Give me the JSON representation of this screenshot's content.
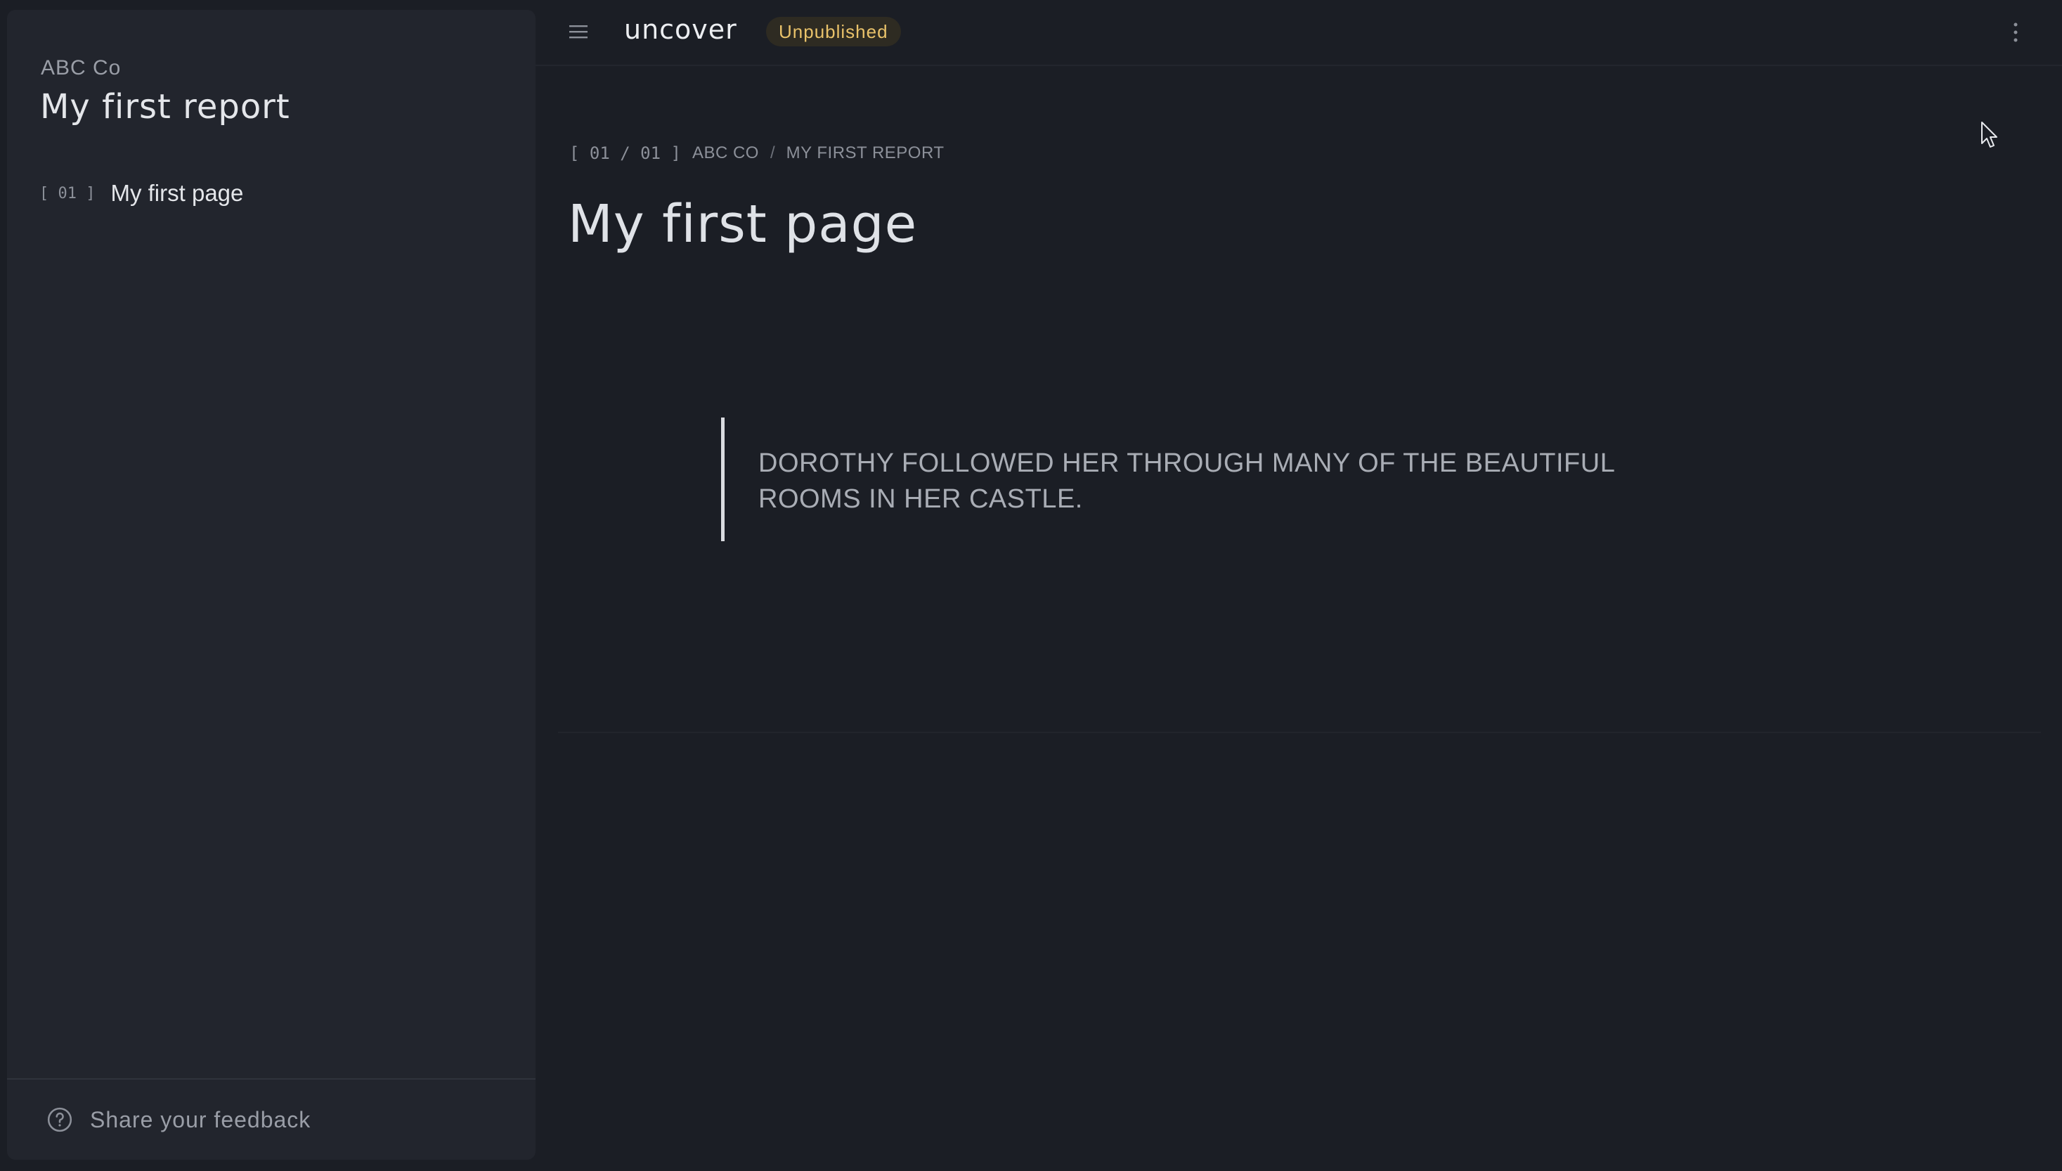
{
  "sidebar": {
    "org_name": "ABC Co",
    "report_title": "My first report",
    "pages": [
      {
        "index": "[ 01 ]",
        "label": "My first page"
      }
    ],
    "footer": {
      "label": "Share your feedback",
      "icon": "help-circle-icon"
    }
  },
  "header": {
    "menu_icon": "hamburger-icon",
    "logo_text": "uncover",
    "status_badge": "Unpublished",
    "more_icon": "kebab-vertical-icon"
  },
  "main": {
    "breadcrumb": {
      "index": "[ 01 / 01 ]",
      "items": [
        "ABC CO",
        "MY FIRST REPORT"
      ],
      "separator": "/"
    },
    "page_title": "My first page",
    "quote_text": "DOROTHY FOLLOWED HER THROUGH MANY OF THE BEAUTIFUL ROOMS IN HER CASTLE."
  },
  "colors": {
    "background": "#1b1e25",
    "sidebar": "#22252d",
    "badge_text": "#e9c26a",
    "badge_bg": "#2e2b22"
  }
}
